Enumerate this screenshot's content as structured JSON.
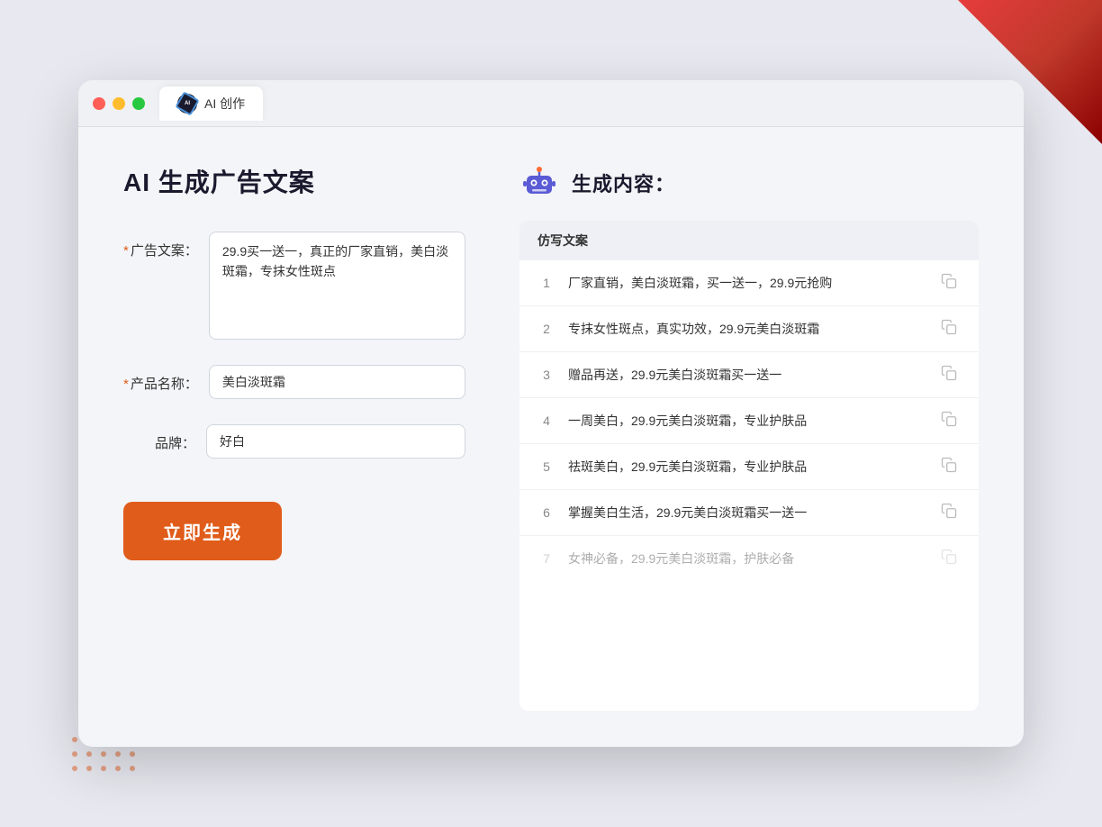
{
  "window": {
    "tab_label": "AI 创作",
    "traffic_lights": [
      "red",
      "yellow",
      "green"
    ]
  },
  "page": {
    "title": "AI 生成广告文案",
    "form": {
      "ad_copy_label": "广告文案：",
      "ad_copy_required": "＊",
      "ad_copy_value": "29.9买一送一，真正的厂家直销，美白淡斑霜，专抹女性斑点",
      "product_name_label": "产品名称：",
      "product_name_required": "＊",
      "product_name_value": "美白淡斑霜",
      "brand_label": "品牌：",
      "brand_value": "好白",
      "generate_btn": "立即生成"
    },
    "result": {
      "header_title": "生成内容：",
      "table_header": "仿写文案",
      "items": [
        {
          "num": "1",
          "text": "厂家直销，美白淡斑霜，买一送一，29.9元抢购",
          "dimmed": false
        },
        {
          "num": "2",
          "text": "专抹女性斑点，真实功效，29.9元美白淡斑霜",
          "dimmed": false
        },
        {
          "num": "3",
          "text": "赠品再送，29.9元美白淡斑霜买一送一",
          "dimmed": false
        },
        {
          "num": "4",
          "text": "一周美白，29.9元美白淡斑霜，专业护肤品",
          "dimmed": false
        },
        {
          "num": "5",
          "text": "祛斑美白，29.9元美白淡斑霜，专业护肤品",
          "dimmed": false
        },
        {
          "num": "6",
          "text": "掌握美白生活，29.9元美白淡斑霜买一送一",
          "dimmed": false
        },
        {
          "num": "7",
          "text": "女神必备，29.9元美白淡斑霜，护肤必备",
          "dimmed": true
        }
      ]
    }
  },
  "colors": {
    "accent_orange": "#e05c1a",
    "required_red": "#e05c1a",
    "bg": "#f4f5f8"
  }
}
